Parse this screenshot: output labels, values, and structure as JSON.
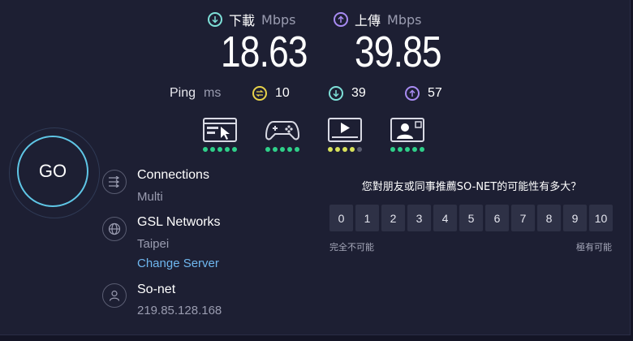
{
  "download": {
    "label": "下載",
    "unit": "Mbps",
    "value": "18.63",
    "color": "#7ee0d8"
  },
  "upload": {
    "label": "上傳",
    "unit": "Mbps",
    "value": "39.85",
    "color": "#a88bf2"
  },
  "ping": {
    "label": "Ping",
    "unit": "ms",
    "idle": "10",
    "download": "39",
    "upload": "57",
    "idle_color": "#e8d24a"
  },
  "usecases": [
    {
      "icon": "web-browsing-icon",
      "rating": 5
    },
    {
      "icon": "gaming-icon",
      "rating": 5
    },
    {
      "icon": "video-streaming-icon",
      "rating": 4
    },
    {
      "icon": "video-chat-icon",
      "rating": 5
    }
  ],
  "go_button": "GO",
  "connections": {
    "title": "Connections",
    "value": "Multi"
  },
  "server": {
    "title": "GSL Networks",
    "location": "Taipei",
    "change_link": "Change Server"
  },
  "provider": {
    "title": "So-net",
    "ip": "219.85.128.168"
  },
  "survey": {
    "question": "您對朋友或同事推薦SO-NET的可能性有多大？",
    "scale": [
      "0",
      "1",
      "2",
      "3",
      "4",
      "5",
      "6",
      "7",
      "8",
      "9",
      "10"
    ],
    "low_label": "完全不可能",
    "high_label": "極有可能"
  }
}
